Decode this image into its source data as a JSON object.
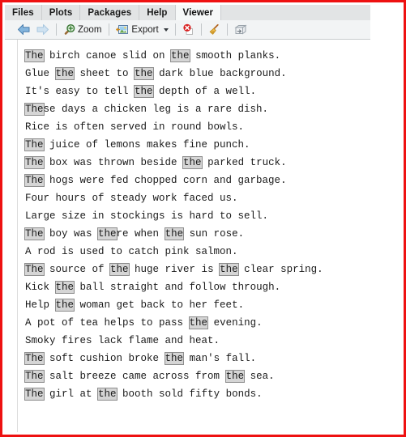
{
  "window": {
    "frame_color": "#ee1111",
    "background": "#ffffff"
  },
  "tabs": {
    "items": [
      {
        "label": "Files",
        "active": false
      },
      {
        "label": "Plots",
        "active": false
      },
      {
        "label": "Packages",
        "active": false
      },
      {
        "label": "Help",
        "active": false
      },
      {
        "label": "Viewer",
        "active": true
      }
    ]
  },
  "toolbar": {
    "back_icon": "arrow-left-icon",
    "forward_icon": "arrow-right-icon",
    "zoom_icon": "magnifier-plus-icon",
    "zoom_label": "Zoom",
    "export_icon": "image-export-icon",
    "export_label": "Export",
    "export_caret": "chevron-down-icon",
    "clear_icon": "red-circle-x-icon",
    "broom_icon": "broom-icon",
    "publish_icon": "publish-icon"
  },
  "viewer": {
    "highlight_term": "the",
    "highlight_background": "#d5d5d5",
    "highlight_border": "#8d8d8d",
    "lines": [
      [
        {
          "t": "The",
          "h": true
        },
        {
          "t": " birch canoe slid on ",
          "h": false
        },
        {
          "t": "the",
          "h": true
        },
        {
          "t": " smooth planks.",
          "h": false
        }
      ],
      [
        {
          "t": "Glue ",
          "h": false
        },
        {
          "t": "the",
          "h": true
        },
        {
          "t": " sheet to ",
          "h": false
        },
        {
          "t": "the",
          "h": true
        },
        {
          "t": " dark blue background.",
          "h": false
        }
      ],
      [
        {
          "t": "It's easy to tell ",
          "h": false
        },
        {
          "t": "the",
          "h": true
        },
        {
          "t": " depth of a well.",
          "h": false
        }
      ],
      [
        {
          "t": "The",
          "h": true
        },
        {
          "t": "se days a chicken leg is a rare dish.",
          "h": false
        }
      ],
      [
        {
          "t": "Rice is often served in round bowls.",
          "h": false
        }
      ],
      [
        {
          "t": "The",
          "h": true
        },
        {
          "t": " juice of lemons makes fine punch.",
          "h": false
        }
      ],
      [
        {
          "t": "The",
          "h": true
        },
        {
          "t": " box was thrown beside ",
          "h": false
        },
        {
          "t": "the",
          "h": true
        },
        {
          "t": " parked truck.",
          "h": false
        }
      ],
      [
        {
          "t": "The",
          "h": true
        },
        {
          "t": " hogs were fed chopped corn and garbage.",
          "h": false
        }
      ],
      [
        {
          "t": "Four hours of steady work faced us.",
          "h": false
        }
      ],
      [
        {
          "t": "Large size in stockings is hard to sell.",
          "h": false
        }
      ],
      [
        {
          "t": "The",
          "h": true
        },
        {
          "t": " boy was ",
          "h": false
        },
        {
          "t": "the",
          "h": true
        },
        {
          "t": "re when ",
          "h": false
        },
        {
          "t": "the",
          "h": true
        },
        {
          "t": " sun rose.",
          "h": false
        }
      ],
      [
        {
          "t": "A rod is used to catch pink salmon.",
          "h": false
        }
      ],
      [
        {
          "t": "The",
          "h": true
        },
        {
          "t": " source of ",
          "h": false
        },
        {
          "t": "the",
          "h": true
        },
        {
          "t": " huge river is ",
          "h": false
        },
        {
          "t": "the",
          "h": true
        },
        {
          "t": " clear spring.",
          "h": false
        }
      ],
      [
        {
          "t": "Kick ",
          "h": false
        },
        {
          "t": "the",
          "h": true
        },
        {
          "t": " ball straight and follow through.",
          "h": false
        }
      ],
      [
        {
          "t": "Help ",
          "h": false
        },
        {
          "t": "the",
          "h": true
        },
        {
          "t": " woman get back to her feet.",
          "h": false
        }
      ],
      [
        {
          "t": "A pot of tea helps to pass ",
          "h": false
        },
        {
          "t": "the",
          "h": true
        },
        {
          "t": " evening.",
          "h": false
        }
      ],
      [
        {
          "t": "Smoky fires lack flame and heat.",
          "h": false
        }
      ],
      [
        {
          "t": "The",
          "h": true
        },
        {
          "t": " soft cushion broke ",
          "h": false
        },
        {
          "t": "the",
          "h": true
        },
        {
          "t": " man's fall.",
          "h": false
        }
      ],
      [
        {
          "t": "The",
          "h": true
        },
        {
          "t": " salt breeze came across from ",
          "h": false
        },
        {
          "t": "the",
          "h": true
        },
        {
          "t": " sea.",
          "h": false
        }
      ],
      [
        {
          "t": "The",
          "h": true
        },
        {
          "t": " girl at ",
          "h": false
        },
        {
          "t": "the",
          "h": true
        },
        {
          "t": " booth sold fifty bonds.",
          "h": false
        }
      ]
    ]
  }
}
